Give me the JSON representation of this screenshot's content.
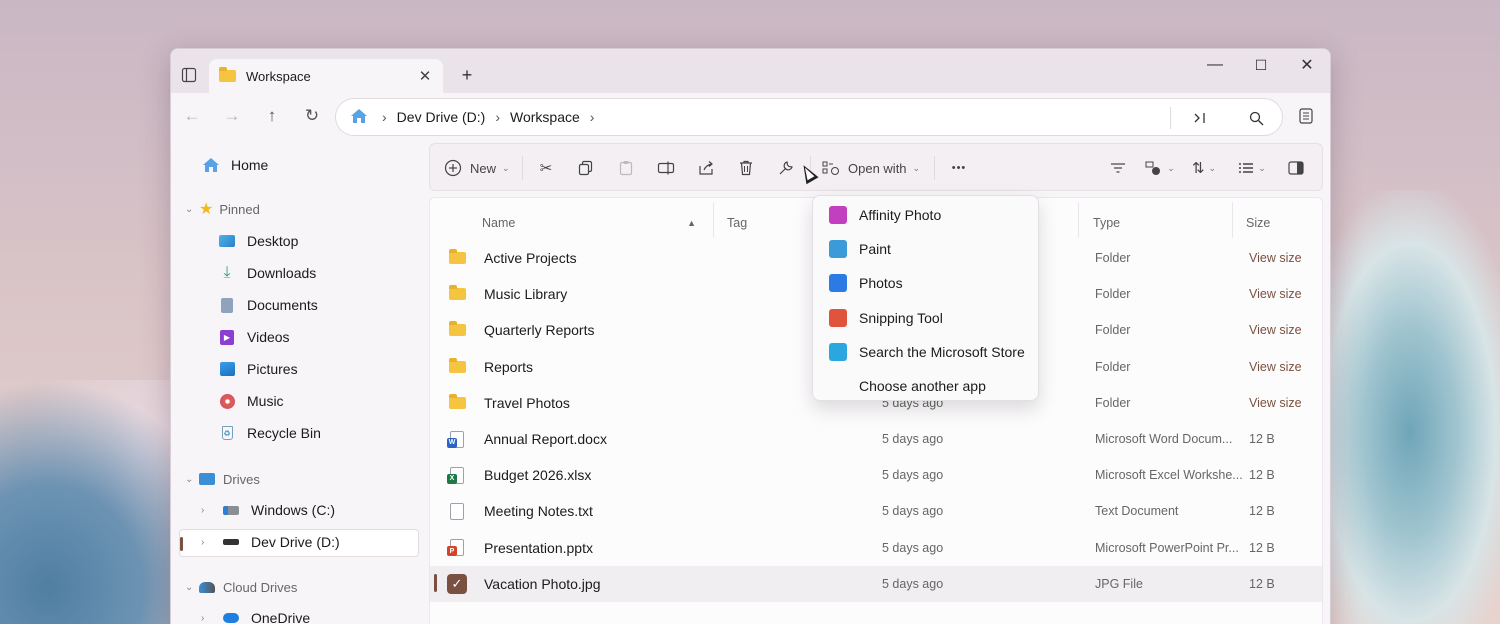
{
  "window": {
    "tab_title": "Workspace",
    "tab_close_glyph": "✕",
    "new_tab_glyph": "+",
    "minimize_glyph": "—",
    "maximize_glyph": "☐",
    "close_glyph": "✕"
  },
  "nav": {
    "back_glyph": "←",
    "forward_glyph": "→",
    "up_glyph": "↑",
    "refresh_glyph": "↻",
    "breadcrumbs": [
      "Dev Drive (D:)",
      "Workspace"
    ],
    "crumb_sep": "›"
  },
  "sidebar": {
    "home": "Home",
    "pinned_header": "Pinned",
    "pinned": [
      "Desktop",
      "Downloads",
      "Documents",
      "Videos",
      "Pictures",
      "Music",
      "Recycle Bin"
    ],
    "drives_header": "Drives",
    "drives": [
      "Windows (C:)",
      "Dev Drive (D:)"
    ],
    "cloud_header": "Cloud Drives",
    "cloud": [
      "OneDrive"
    ]
  },
  "toolbar": {
    "new_label": "New",
    "open_with_label": "Open with",
    "more_glyph": "•••"
  },
  "columns": {
    "name": "Name",
    "tag": "Tag",
    "type": "Type",
    "size": "Size"
  },
  "files": [
    {
      "name": "Active Projects",
      "modified": "",
      "type": "Folder",
      "size": "View size",
      "kind": "folder"
    },
    {
      "name": "Music Library",
      "modified": "",
      "type": "Folder",
      "size": "View size",
      "kind": "folder"
    },
    {
      "name": "Quarterly Reports",
      "modified": "",
      "type": "Folder",
      "size": "View size",
      "kind": "folder"
    },
    {
      "name": "Reports",
      "modified": "",
      "type": "Folder",
      "size": "View size",
      "kind": "folder"
    },
    {
      "name": "Travel Photos",
      "modified": "5 days ago",
      "type": "Folder",
      "size": "View size",
      "kind": "folder"
    },
    {
      "name": "Annual Report.docx",
      "modified": "5 days ago",
      "type": "Microsoft Word Docum...",
      "size": "12 B",
      "kind": "word"
    },
    {
      "name": "Budget 2026.xlsx",
      "modified": "5 days ago",
      "type": "Microsoft Excel Workshe...",
      "size": "12 B",
      "kind": "excel"
    },
    {
      "name": "Meeting Notes.txt",
      "modified": "5 days ago",
      "type": "Text Document",
      "size": "12 B",
      "kind": "text"
    },
    {
      "name": "Presentation.pptx",
      "modified": "5 days ago",
      "type": "Microsoft PowerPoint Pr...",
      "size": "12 B",
      "kind": "ppt"
    },
    {
      "name": "Vacation Photo.jpg",
      "modified": "5 days ago",
      "type": "JPG File",
      "size": "12 B",
      "kind": "jpg",
      "selected": true
    }
  ],
  "open_with_menu": [
    {
      "label": "Affinity Photo",
      "icon": "affinity-photo-icon",
      "color": "#c23fbf"
    },
    {
      "label": "Paint",
      "icon": "paint-icon",
      "color": "#3a9bd8"
    },
    {
      "label": "Photos",
      "icon": "photos-icon",
      "color": "#2c7be5"
    },
    {
      "label": "Snipping Tool",
      "icon": "snipping-tool-icon",
      "color": "#e0533d"
    },
    {
      "label": "Search the Microsoft Store",
      "icon": "store-icon",
      "color": "#2aa7df"
    },
    {
      "label": "Choose another app",
      "icon": "",
      "color": ""
    }
  ]
}
